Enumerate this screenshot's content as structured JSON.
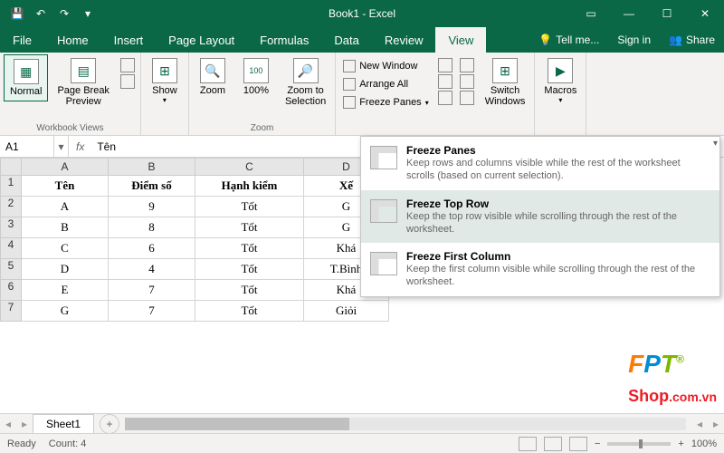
{
  "title": "Book1 - Excel",
  "tabs": {
    "file": "File",
    "home": "Home",
    "insert": "Insert",
    "page_layout": "Page Layout",
    "formulas": "Formulas",
    "data": "Data",
    "review": "Review",
    "view": "View",
    "tell_me": "Tell me...",
    "sign_in": "Sign in",
    "share": "Share"
  },
  "ribbon": {
    "workbook_views": {
      "label": "Workbook Views",
      "normal": "Normal",
      "page_break": "Page Break\nPreview"
    },
    "show": {
      "label": "Show",
      "btn": "Show"
    },
    "zoom": {
      "label": "Zoom",
      "zoom": "Zoom",
      "z100": "100%",
      "to_sel": "Zoom to\nSelection"
    },
    "window": {
      "new_window": "New Window",
      "arrange_all": "Arrange All",
      "freeze_panes": "Freeze Panes",
      "switch": "Switch\nWindows"
    },
    "macros": {
      "macros": "Macros"
    }
  },
  "freeze_menu": {
    "panes": {
      "title": "Freeze Panes",
      "desc": "Keep rows and columns visible while the rest of the worksheet scrolls (based on current selection)."
    },
    "top_row": {
      "title": "Freeze Top Row",
      "desc": "Keep the top row visible while scrolling through the rest of the worksheet."
    },
    "first_col": {
      "title": "Freeze First Column",
      "desc": "Keep the first column visible while scrolling through the rest of the worksheet."
    }
  },
  "namebox": "A1",
  "formula_value": "Tên",
  "cols": [
    "A",
    "B",
    "C",
    "D"
  ],
  "headers": {
    "c1": "Tên",
    "c2": "Điểm số",
    "c3": "Hạnh kiểm",
    "c4": "Xế"
  },
  "rows": [
    {
      "n": "2",
      "c1": "A",
      "c2": "9",
      "c3": "Tốt",
      "c4": "G"
    },
    {
      "n": "3",
      "c1": "B",
      "c2": "8",
      "c3": "Tốt",
      "c4": "G"
    },
    {
      "n": "4",
      "c1": "C",
      "c2": "6",
      "c3": "Tốt",
      "c4": "Khá"
    },
    {
      "n": "5",
      "c1": "D",
      "c2": "4",
      "c3": "Tốt",
      "c4": "T.Bình"
    },
    {
      "n": "6",
      "c1": "E",
      "c2": "7",
      "c3": "Tốt",
      "c4": "Khá"
    },
    {
      "n": "7",
      "c1": "G",
      "c2": "7",
      "c3": "Tốt",
      "c4": "Giỏi"
    }
  ],
  "sheet_tab": "Sheet1",
  "status": {
    "ready": "Ready",
    "count": "Count: 4",
    "zoom": "100%"
  },
  "watermark": {
    "f": "F",
    "p": "P",
    "t": "T",
    "shop": "Shop",
    "dom": ".com.vn"
  }
}
